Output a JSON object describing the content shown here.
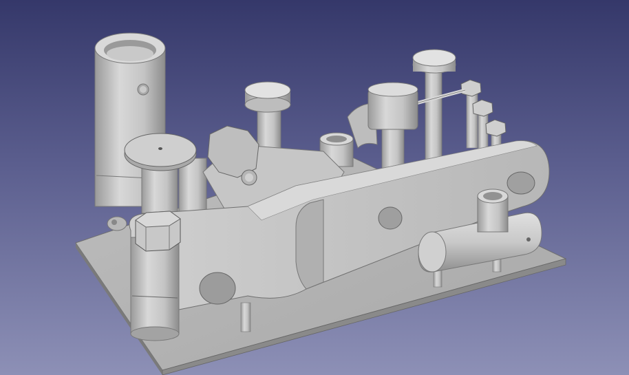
{
  "viewport": {
    "background_top": "#35386a",
    "background_bottom": "#8d90b6",
    "model_color": "#c4c4c4"
  },
  "scene": {
    "model_parts": [
      "base-plate",
      "tall-cylinder",
      "bracket-cylinder",
      "round-plate",
      "hex-nut-front",
      "main-beam",
      "beam-riser",
      "front-pin-knob",
      "rear-pin-knob",
      "small-cylinder-housing",
      "hex-nut-small",
      "side-cylinder",
      "side-cylinder-neck",
      "support-post"
    ]
  }
}
